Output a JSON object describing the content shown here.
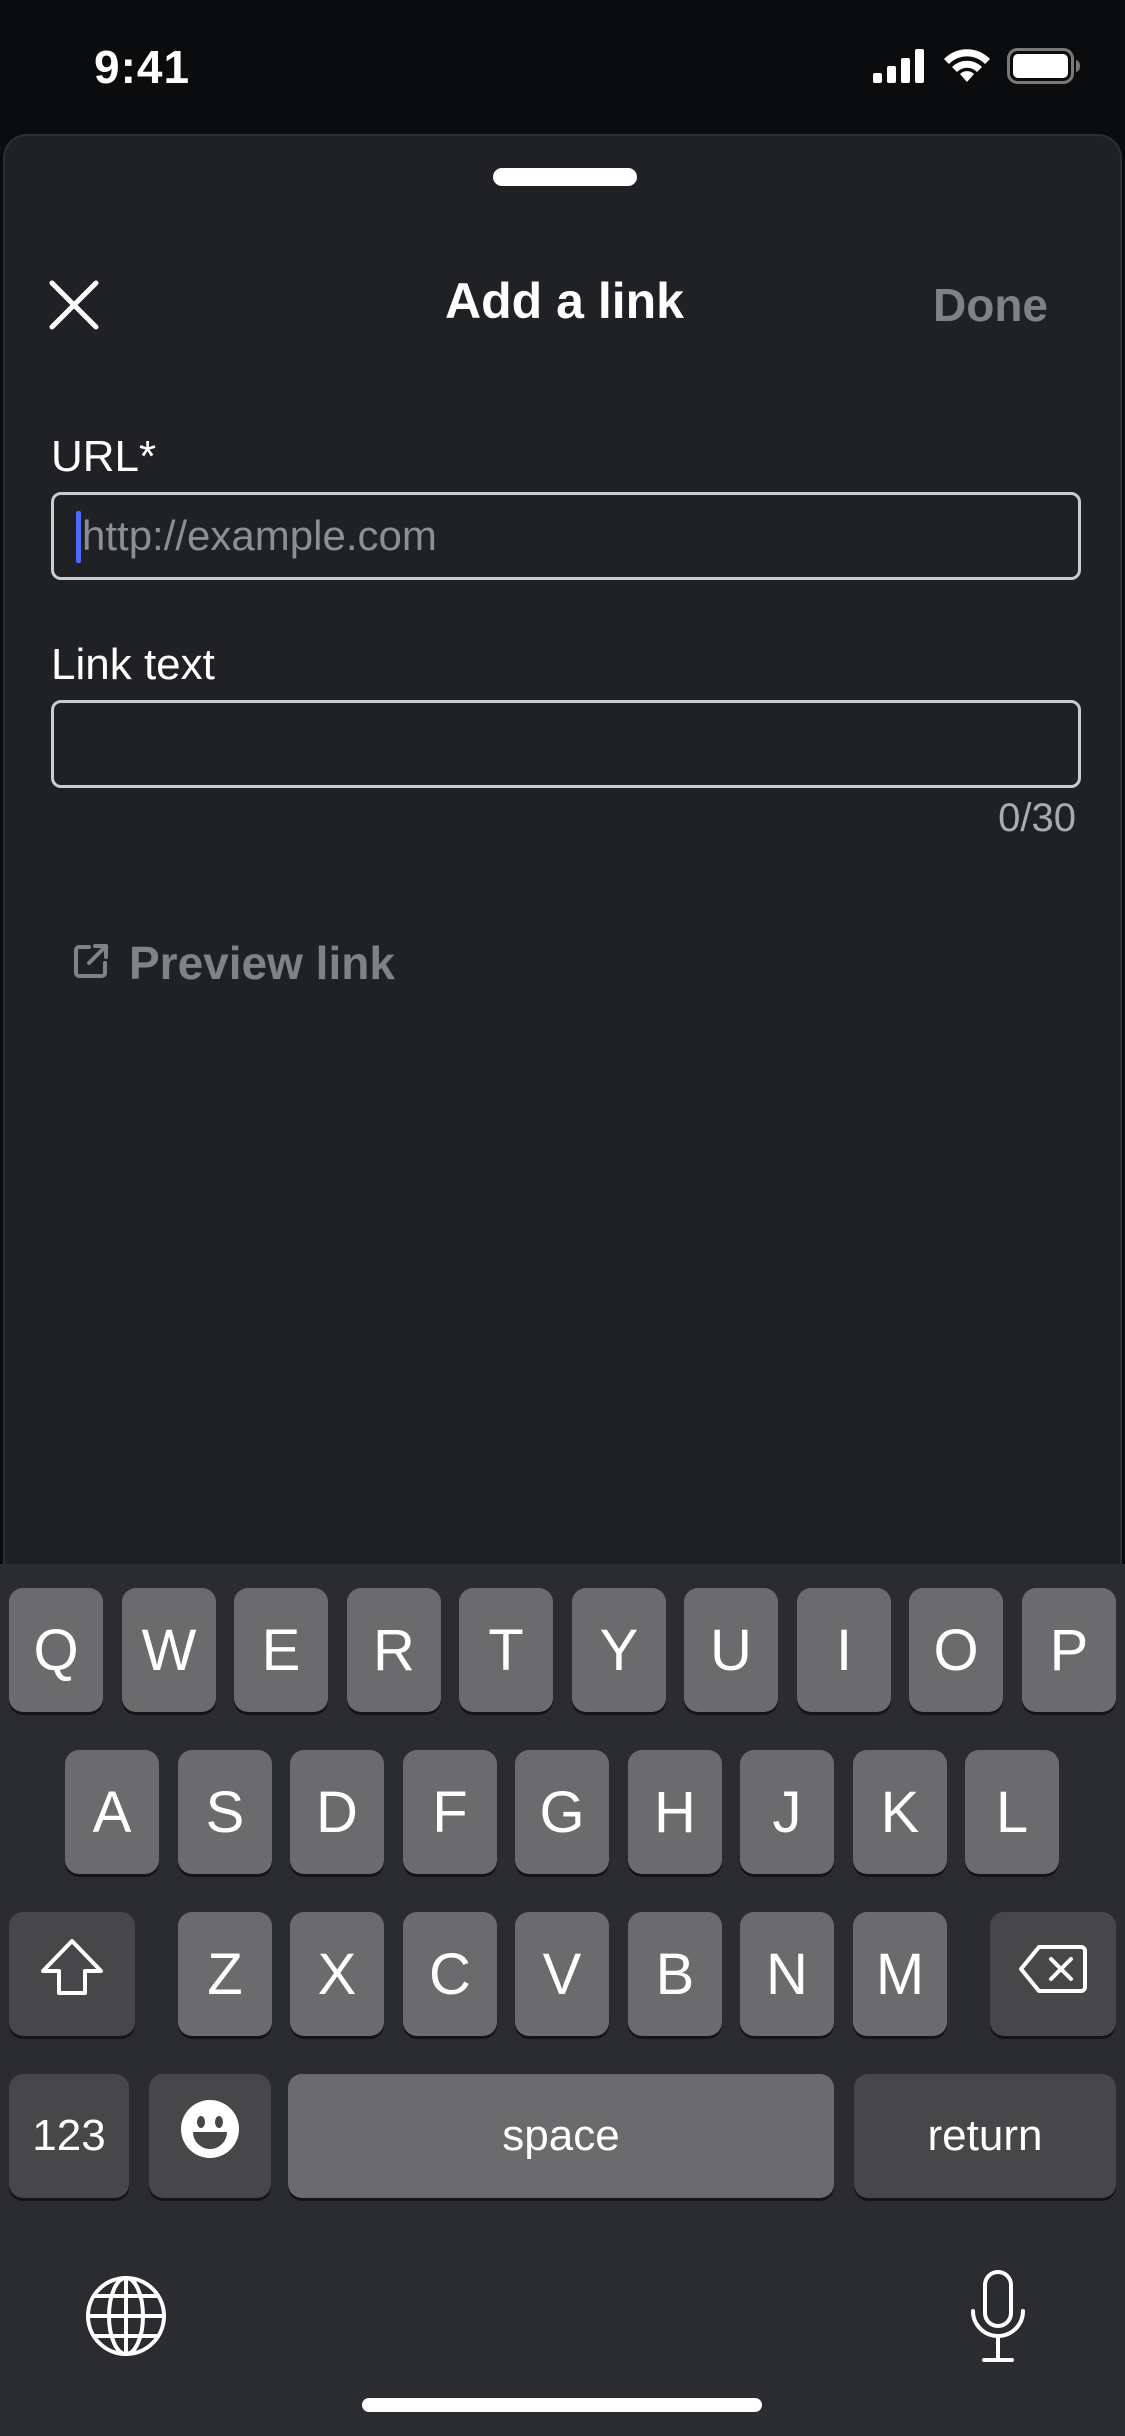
{
  "status_bar": {
    "time": "9:41"
  },
  "sheet": {
    "title": "Add a link",
    "done_label": "Done",
    "url_field": {
      "label": "URL*",
      "value": "",
      "placeholder": "http://example.com"
    },
    "link_text_field": {
      "label": "Link text",
      "value": "",
      "placeholder": "",
      "counter": "0/30"
    },
    "preview_label": "Preview link"
  },
  "keyboard": {
    "row1": [
      "Q",
      "W",
      "E",
      "R",
      "T",
      "Y",
      "U",
      "I",
      "O",
      "P"
    ],
    "row2": [
      "A",
      "S",
      "D",
      "F",
      "G",
      "H",
      "J",
      "K",
      "L"
    ],
    "row3": [
      "Z",
      "X",
      "C",
      "V",
      "B",
      "N",
      "M"
    ],
    "numbers_label": "123",
    "space_label": "space",
    "return_label": "return"
  },
  "colors": {
    "sheet_background": "#1f2125",
    "caret": "#4f6bff",
    "disabled_text": "#7f8287",
    "keyboard_background": "#2b2c2f",
    "key_light": "#6b6b6d",
    "key_dark": "#474749"
  },
  "icons": {
    "close": "close-icon",
    "preview": "external-link-icon",
    "shift": "shift-icon",
    "backspace": "backspace-icon",
    "emoji": "emoji-icon",
    "globe": "globe-icon",
    "microphone": "microphone-icon",
    "signal": "cellular-signal-icon",
    "wifi": "wifi-icon",
    "battery": "battery-icon"
  }
}
